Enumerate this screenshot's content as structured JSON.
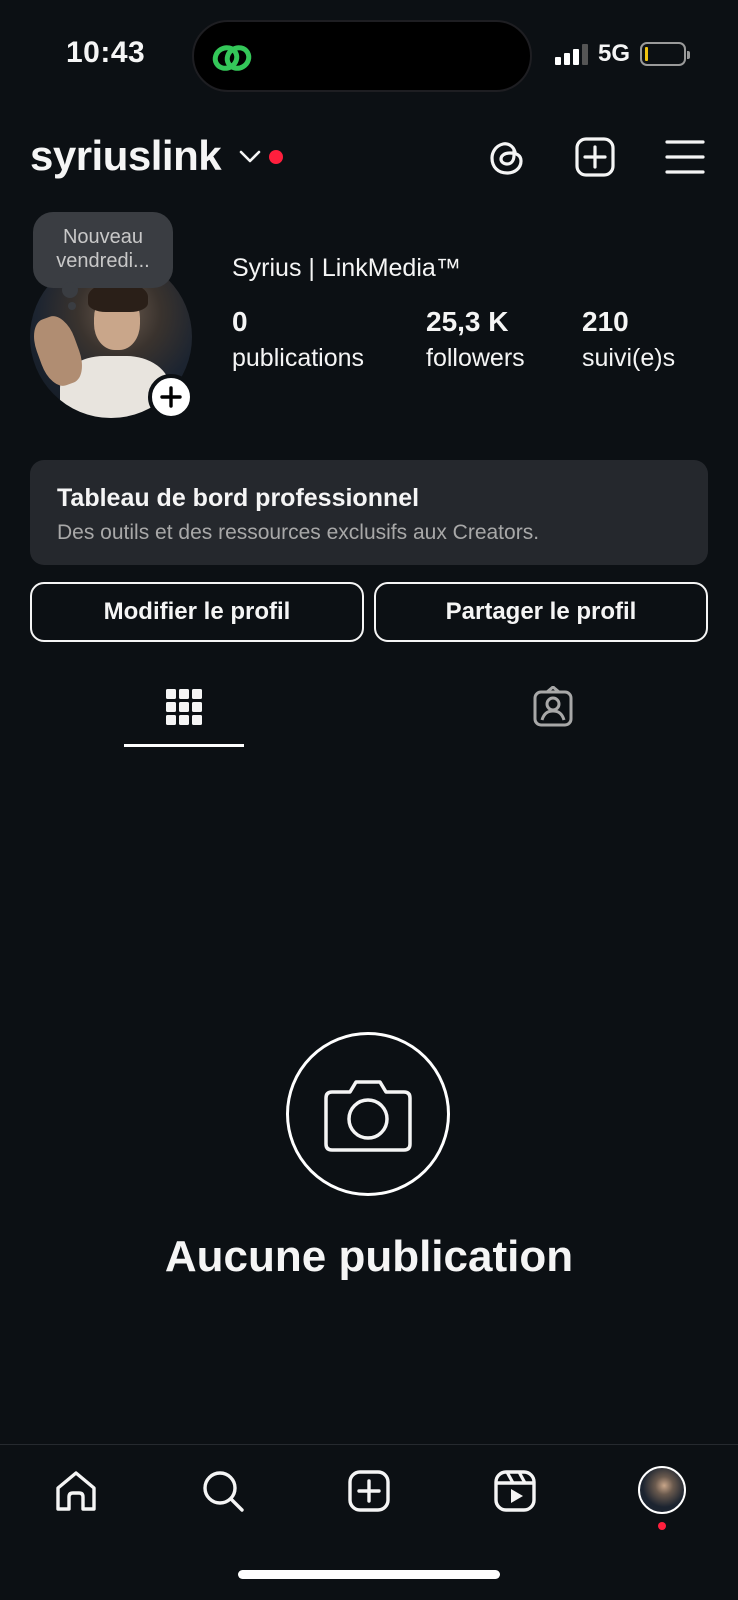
{
  "status_bar": {
    "time": "10:43",
    "network": "5G",
    "island_icon": "threads-link-icon",
    "accent_color": "#34c759"
  },
  "header": {
    "username": "syriuslink",
    "icons": [
      "chevron-down-icon",
      "threads-icon",
      "create-post-icon",
      "menu-icon"
    ]
  },
  "note": {
    "line1": "Nouveau",
    "line2": "vendredi..."
  },
  "profile": {
    "display_name": "Syrius | LinkMedia™",
    "stats": [
      {
        "value": "0",
        "label": "publications"
      },
      {
        "value": "25,3 K",
        "label": "followers"
      },
      {
        "value": "210",
        "label": "suivi(e)s"
      }
    ]
  },
  "pro_dashboard": {
    "title": "Tableau de bord professionnel",
    "subtitle": "Des outils et des ressources exclusifs aux Creators."
  },
  "actions": {
    "edit_label": "Modifier le profil",
    "share_label": "Partager le profil"
  },
  "tabs": [
    {
      "icon": "grid-icon",
      "active": true
    },
    {
      "icon": "tagged-icon",
      "active": false
    }
  ],
  "empty_state": {
    "icon": "camera-icon",
    "title": "Aucune publication"
  },
  "bottom_nav": {
    "items": [
      "home-icon",
      "search-icon",
      "create-icon",
      "reels-icon",
      "profile-avatar"
    ]
  },
  "colors": {
    "background": "#0c1014",
    "card": "#25282d",
    "notification": "#ff1f3d"
  }
}
